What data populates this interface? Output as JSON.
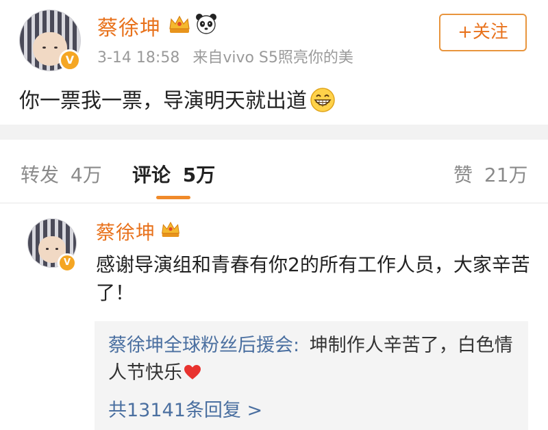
{
  "post": {
    "author": "蔡徐坤",
    "time": "3-14 18:58",
    "source": "来自vivo S5照亮你的美",
    "follow_label": "+关注",
    "text": "你一票我一票，导演明天就出道",
    "icons": [
      "crown-icon",
      "panda-icon",
      "grin-emoji-icon",
      "verified-v-icon"
    ]
  },
  "tabs": {
    "repost_label": "转发",
    "repost_count": "4万",
    "comment_label": "评论",
    "comment_count": "5万",
    "like_label": "赞",
    "like_count": "21万"
  },
  "comment": {
    "author": "蔡徐坤",
    "text": "感谢导演组和青春有你2的所有工作人员，大家辛苦了！",
    "reply": {
      "author": "蔡徐坤全球粉丝后援会:",
      "text": "坤制作人辛苦了，白色情人节快乐",
      "count_text": "共13141条回复 >"
    }
  },
  "colors": {
    "accent": "#e8721c",
    "link": "#4a6fa0",
    "muted": "#9a9a9a",
    "divider": "#f2f2f2"
  }
}
